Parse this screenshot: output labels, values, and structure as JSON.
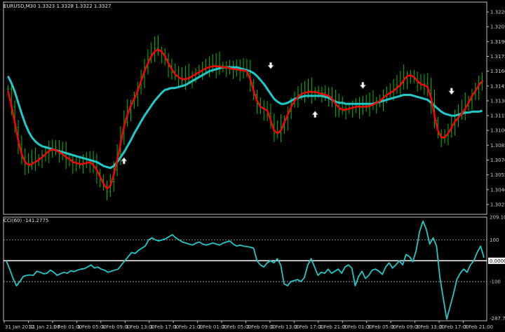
{
  "window": {
    "main_title": "EURUSD,M30  1.3323 1.3328 1.3322 1.3327",
    "cci_title": "CCI(60) -141.2775"
  },
  "colors": {
    "background": "#000000",
    "grid_and_axes": "#c0c0c0",
    "price_bars": "#00c000",
    "fast_ma": "#ff0000",
    "slow_ma": "#20c8c8",
    "cci": "#20c8c8",
    "arrow_fill": "#ffffff"
  },
  "chart_data": [
    {
      "type": "line",
      "panel": "price",
      "ylim": [
        1.3015,
        1.323
      ],
      "y_ticks": [
        "1.3220",
        "1.3205",
        "1.3190",
        "1.3175",
        "1.3160",
        "1.3145",
        "1.3130",
        "1.3115",
        "1.3100",
        "1.3085",
        "1.3070",
        "1.3055",
        "1.3040",
        "1.3025"
      ],
      "x_tick_labels": [
        "31 Jan 2012",
        "31 Jan 21:00",
        "1 Feb 01:00",
        "1 Feb 05:00",
        "1 Feb 09:00",
        "1 Feb 13:00",
        "1 Feb 17:00",
        "1 Feb 21:00",
        "2 Feb 01:00",
        "2 Feb 05:00",
        "2 Feb 09:00",
        "2 Feb 13:00",
        "2 Feb 17:00",
        "2 Feb 21:00",
        "3 Feb 01:00",
        "3 Feb 05:00",
        "3 Feb 09:00",
        "3 Feb 13:00",
        "3 Feb 17:00",
        "3 Feb 21:00"
      ],
      "bar_count": 140,
      "series": [
        {
          "role": "slow_ma",
          "values": [
            1.3155,
            1.3148,
            1.3139,
            1.3128,
            1.3117,
            1.3107,
            1.3099,
            1.3093,
            1.3089,
            1.3086,
            1.3084,
            1.3083,
            1.3082,
            1.3081,
            1.308,
            1.3079,
            1.3078,
            1.3077,
            1.3076,
            1.3075,
            1.3074,
            1.3073,
            1.3072,
            1.3071,
            1.307,
            1.3069,
            1.3068,
            1.3066,
            1.3064,
            1.3063,
            1.3062,
            1.3064,
            1.3068,
            1.3073,
            1.3078,
            1.3084,
            1.309,
            1.3097,
            1.3103,
            1.3109,
            1.3115,
            1.312,
            1.3125,
            1.313,
            1.3134,
            1.3138,
            1.3141,
            1.3142,
            1.3143,
            1.3143,
            1.3144,
            1.3145,
            1.3146,
            1.3148,
            1.315,
            1.3152,
            1.3154,
            1.3156,
            1.3158,
            1.316,
            1.3161,
            1.3162,
            1.3163,
            1.3164,
            1.3164,
            1.3164,
            1.3164,
            1.3164,
            1.3163,
            1.3162,
            1.3161,
            1.316,
            1.3158,
            1.3155,
            1.3151,
            1.3147,
            1.3142,
            1.3137,
            1.3132,
            1.3129,
            1.3127,
            1.3127,
            1.3128,
            1.313,
            1.3132,
            1.3133,
            1.3134,
            1.3135,
            1.3135,
            1.3135,
            1.3135,
            1.3135,
            1.3135,
            1.3134,
            1.3133,
            1.3131,
            1.3129,
            1.3128,
            1.3128,
            1.3127,
            1.3127,
            1.3127,
            1.3127,
            1.3127,
            1.3127,
            1.3127,
            1.3127,
            1.3127,
            1.3128,
            1.3129,
            1.313,
            1.3131,
            1.3132,
            1.3133,
            1.3134,
            1.3135,
            1.3136,
            1.3136,
            1.3136,
            1.3135,
            1.3134,
            1.3133,
            1.3132,
            1.3131,
            1.3128,
            1.3125,
            1.3122,
            1.3119,
            1.3117,
            1.3116,
            1.3115,
            1.3115,
            1.3116,
            1.3117,
            1.3118,
            1.3118,
            1.3119,
            1.3119,
            1.3119,
            1.312
          ]
        },
        {
          "role": "fast_ma",
          "values": [
            1.314,
            1.3125,
            1.3108,
            1.309,
            1.3076,
            1.3068,
            1.3065,
            1.3066,
            1.3068,
            1.307,
            1.3073,
            1.3076,
            1.3079,
            1.3081,
            1.308,
            1.3078,
            1.3076,
            1.3073,
            1.3071,
            1.3068,
            1.3067,
            1.3066,
            1.3066,
            1.3067,
            1.3068,
            1.3065,
            1.306,
            1.3053,
            1.3046,
            1.3041,
            1.3044,
            1.3055,
            1.307,
            1.3087,
            1.3104,
            1.3116,
            1.3125,
            1.3132,
            1.314,
            1.315,
            1.316,
            1.3168,
            1.3175,
            1.318,
            1.3182,
            1.318,
            1.3175,
            1.3168,
            1.3162,
            1.3157,
            1.3154,
            1.3152,
            1.3152,
            1.3153,
            1.3155,
            1.3157,
            1.3159,
            1.3161,
            1.3163,
            1.3164,
            1.3165,
            1.3165,
            1.3165,
            1.3164,
            1.3164,
            1.3163,
            1.3162,
            1.3162,
            1.3161,
            1.3161,
            1.316,
            1.3152,
            1.314,
            1.313,
            1.3124,
            1.3122,
            1.312,
            1.311,
            1.31,
            1.3097,
            1.31,
            1.3108,
            1.3116,
            1.3124,
            1.313,
            1.3134,
            1.3137,
            1.3138,
            1.3139,
            1.3139,
            1.3139,
            1.3138,
            1.3137,
            1.3136,
            1.3135,
            1.3132,
            1.3127,
            1.3123,
            1.3121,
            1.3121,
            1.3122,
            1.3123,
            1.3124,
            1.3124,
            1.3124,
            1.3124,
            1.3125,
            1.3126,
            1.3128,
            1.313,
            1.3133,
            1.3136,
            1.3138,
            1.314,
            1.3143,
            1.3146,
            1.3151,
            1.3155,
            1.3156,
            1.3154,
            1.315,
            1.3147,
            1.3146,
            1.3144,
            1.3133,
            1.3115,
            1.31,
            1.3093,
            1.3093,
            1.3097,
            1.3103,
            1.3109,
            1.3113,
            1.3117,
            1.3122,
            1.3128,
            1.3135,
            1.314,
            1.3146,
            1.315
          ]
        },
        {
          "role": "close",
          "values": [
            1.3142,
            1.3124,
            1.3103,
            1.3086,
            1.3072,
            1.3066,
            1.3064,
            1.3068,
            1.3069,
            1.3072,
            1.3075,
            1.3078,
            1.3082,
            1.308,
            1.3079,
            1.3076,
            1.3075,
            1.3071,
            1.307,
            1.3067,
            1.3066,
            1.3065,
            1.3067,
            1.3068,
            1.3067,
            1.3063,
            1.3057,
            1.305,
            1.3043,
            1.3038,
            1.3048,
            1.306,
            1.3076,
            1.3093,
            1.3108,
            1.3118,
            1.3127,
            1.3134,
            1.3143,
            1.3154,
            1.3164,
            1.3172,
            1.3178,
            1.3183,
            1.3181,
            1.3178,
            1.3172,
            1.3165,
            1.3159,
            1.3155,
            1.3153,
            1.3151,
            1.3153,
            1.3154,
            1.3156,
            1.3158,
            1.316,
            1.3162,
            1.3164,
            1.3165,
            1.3166,
            1.3164,
            1.3166,
            1.3163,
            1.3165,
            1.3162,
            1.3163,
            1.3161,
            1.3162,
            1.316,
            1.3158,
            1.3148,
            1.3136,
            1.3127,
            1.3123,
            1.3121,
            1.3117,
            1.3106,
            1.3097,
            1.3098,
            1.3103,
            1.3111,
            1.3119,
            1.3127,
            1.3132,
            1.3136,
            1.3138,
            1.3139,
            1.314,
            1.3138,
            1.314,
            1.3137,
            1.3138,
            1.3135,
            1.3134,
            1.313,
            1.3125,
            1.3121,
            1.312,
            1.3122,
            1.3123,
            1.3124,
            1.3125,
            1.3123,
            1.3125,
            1.3123,
            1.3126,
            1.3127,
            1.313,
            1.3131,
            1.3135,
            1.3137,
            1.3139,
            1.3142,
            1.3145,
            1.3148,
            1.3153,
            1.3156,
            1.3155,
            1.3152,
            1.3148,
            1.3146,
            1.3147,
            1.3141,
            1.3128,
            1.311,
            1.3096,
            1.3092,
            1.3095,
            1.3099,
            1.3106,
            1.3111,
            1.3115,
            1.3119,
            1.3125,
            1.3131,
            1.3137,
            1.3142,
            1.3148,
            1.315
          ]
        }
      ],
      "arrows": [
        {
          "bar": 34,
          "price": 1.3069,
          "direction": "up"
        },
        {
          "bar": 77,
          "price": 1.3166,
          "direction": "down"
        },
        {
          "bar": 90,
          "price": 1.3116,
          "direction": "up"
        },
        {
          "bar": 104,
          "price": 1.3146,
          "direction": "down"
        },
        {
          "bar": 130,
          "price": 1.314,
          "direction": "down"
        }
      ]
    },
    {
      "type": "line",
      "panel": "cci",
      "title": "CCI(60) -141.2775",
      "ylim": [
        -287.71,
        209.1
      ],
      "y_ticks": [
        "209.1010",
        "100",
        "0.0000",
        "-100",
        "-287.7100"
      ],
      "reference_lines": [
        100,
        0,
        -100
      ],
      "series": [
        {
          "name": "CCI(60)",
          "values": [
            0,
            -40,
            -85,
            -120,
            -100,
            -75,
            -70,
            -68,
            -70,
            -50,
            -55,
            -62,
            -60,
            -45,
            -55,
            -70,
            -62,
            -55,
            -60,
            -48,
            -52,
            -45,
            -40,
            -38,
            -30,
            -20,
            -35,
            -30,
            -40,
            -45,
            -55,
            -50,
            -45,
            -40,
            -20,
            0,
            20,
            40,
            35,
            50,
            60,
            70,
            100,
            110,
            100,
            95,
            100,
            105,
            115,
            125,
            110,
            100,
            90,
            85,
            80,
            75,
            85,
            90,
            80,
            75,
            80,
            85,
            80,
            75,
            85,
            90,
            95,
            80,
            70,
            75,
            70,
            68,
            65,
            60,
            0,
            -20,
            -30,
            -10,
            0,
            -10,
            10,
            -20,
            -110,
            -120,
            -100,
            -95,
            -90,
            -100,
            -80,
            -20,
            10,
            -30,
            -70,
            -55,
            -60,
            -40,
            -60,
            -50,
            -40,
            -60,
            -30,
            -20,
            -35,
            -120,
            -75,
            -50,
            -85,
            -70,
            -45,
            -40,
            -50,
            -65,
            -30,
            -10,
            -35,
            -20,
            0,
            -20,
            30,
            20,
            -5,
            50,
            140,
            190,
            150,
            80,
            110,
            70,
            -80,
            -180,
            -280,
            -220,
            -160,
            -90,
            -60,
            -40,
            -55,
            -20,
            0,
            40,
            70,
            15
          ]
        }
      ]
    }
  ]
}
